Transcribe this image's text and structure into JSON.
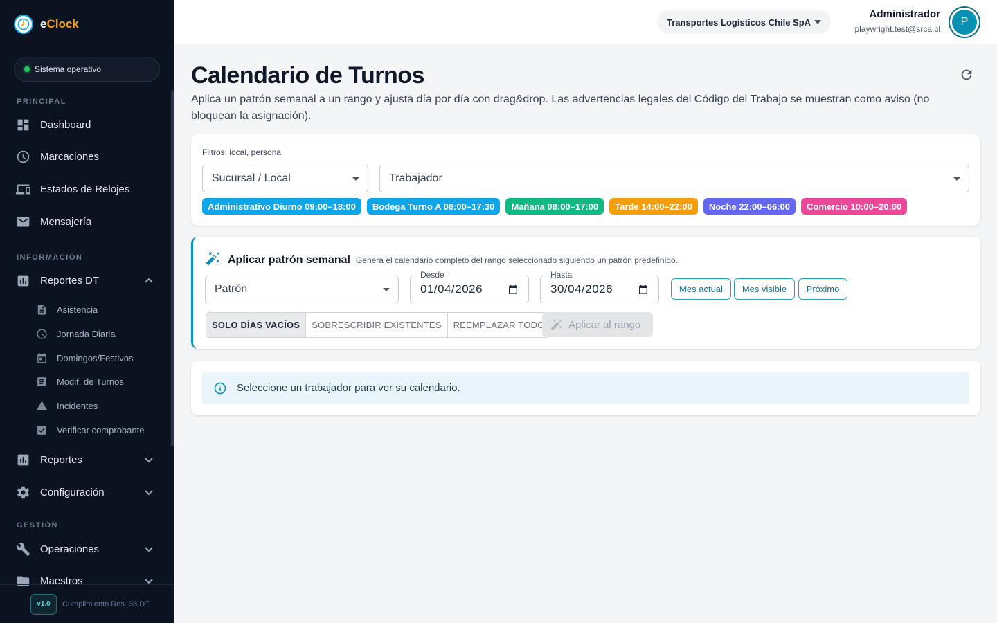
{
  "app": {
    "name_main": "e",
    "name_accent": "Clock"
  },
  "status": "Sistema operativo",
  "sidebar": {
    "sections": {
      "principal": "PRINCIPAL",
      "informacion": "INFORMACIÓN",
      "gestion": "GESTIÓN"
    },
    "items": [
      {
        "label": "Dashboard",
        "icon": "dashboard-icon"
      },
      {
        "label": "Marcaciones",
        "icon": "clock-icon"
      },
      {
        "label": "Estados de Relojes",
        "icon": "devices-icon"
      },
      {
        "label": "Mensajería",
        "icon": "mail-icon"
      },
      {
        "label": "Reportes DT",
        "icon": "bar-chart-icon"
      },
      {
        "label": "Reportes",
        "icon": "bar-chart-icon"
      },
      {
        "label": "Configuración",
        "icon": "gear-icon"
      },
      {
        "label": "Operaciones",
        "icon": "wrench-icon"
      },
      {
        "label": "Maestros",
        "icon": "folder-icon"
      }
    ],
    "sub_items": [
      {
        "label": "Asistencia",
        "icon": "document-icon"
      },
      {
        "label": "Jornada Diaria",
        "icon": "clock-icon"
      },
      {
        "label": "Domingos/Festivos",
        "icon": "calendar-icon"
      },
      {
        "label": "Modif. de Turnos",
        "icon": "clipboard-icon"
      },
      {
        "label": "Incidentes",
        "icon": "warning-icon"
      },
      {
        "label": "Verificar comprobante",
        "icon": "checklist-icon"
      }
    ],
    "footer": {
      "version": "v1.0",
      "text": "Cumplimiento Res. 38 DT"
    }
  },
  "topbar": {
    "company": "Transportes Logísticos Chile SpA",
    "user_name": "Administrador",
    "user_email": "playwright.test@srca.cl",
    "avatar_letter": "P"
  },
  "page": {
    "title": "Calendario de Turnos",
    "subtitle": "Aplica un patrón semanal a un rango y ajusta día por día con drag&drop. Las advertencias legales del Código del Trabajo se muestran como aviso (no bloquean la asignación)."
  },
  "filters": {
    "label": "Filtros: local, persona",
    "sucursal_placeholder": "Sucursal / Local",
    "trabajador_placeholder": "Trabajador",
    "shifts": [
      {
        "label": "Administrativo Diurno 09:00–18:00",
        "color": "#0ea5e9"
      },
      {
        "label": "Bodega Turno A 08:00–17:30",
        "color": "#0ea5e9"
      },
      {
        "label": "Mañana 08:00–17:00",
        "color": "#10b981"
      },
      {
        "label": "Tarde 14:00–22:00",
        "color": "#f59e0b"
      },
      {
        "label": "Noche 22:00–06:00",
        "color": "#6366f1"
      },
      {
        "label": "Comercio 10:00–20:00",
        "color": "#ec4899"
      }
    ]
  },
  "pattern": {
    "title": "Aplicar patrón semanal",
    "description": "Genera el calendario completo del rango seleccionado siguiendo un patrón predefinido.",
    "pattern_placeholder": "Patrón",
    "desde_label": "Desde",
    "desde_value": "01/04/2026",
    "hasta_label": "Hasta",
    "hasta_value": "30/04/2026",
    "quick": [
      "Mes actual",
      "Mes visible",
      "Próximo"
    ],
    "modes": [
      "SOLO DÍAS VACÍOS",
      "SOBRESCRIBIR EXISTENTES",
      "REEMPLAZAR TODO"
    ],
    "apply_label": "Aplicar al rango"
  },
  "info": {
    "message": "Seleccione un trabajador para ver su calendario."
  },
  "colors": {
    "accent": "#0891b2",
    "sidebar_bg": "#0b1220",
    "brand_accent": "#f59e0b"
  }
}
